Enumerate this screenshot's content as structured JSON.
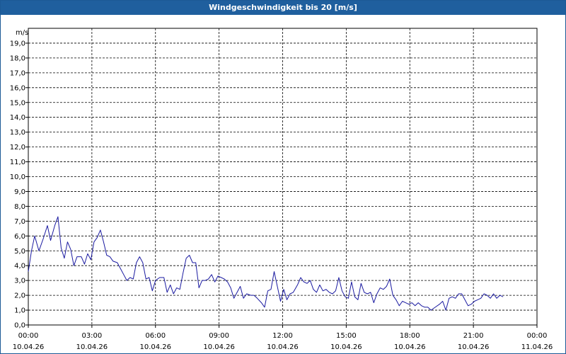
{
  "window": {
    "title": "Windgeschwindigkeit bis 20 [m/s]"
  },
  "chart_data": {
    "type": "line",
    "title": "Windgeschwindigkeit bis 20 [m/s]",
    "ylabel": "m/s",
    "xlabel": "",
    "ylim": [
      0,
      20
    ],
    "xlim_hours": [
      0,
      24
    ],
    "grid": true,
    "y_ticks": [
      "0,0",
      "1,0",
      "2,0",
      "3,0",
      "4,0",
      "5,0",
      "6,0",
      "7,0",
      "8,0",
      "9,0",
      "10,0",
      "11,0",
      "12,0",
      "13,0",
      "14,0",
      "15,0",
      "16,0",
      "17,0",
      "18,0",
      "19,0"
    ],
    "x_ticks": [
      {
        "time": "00:00",
        "date": "10.04.26"
      },
      {
        "time": "03:00",
        "date": "10.04.26"
      },
      {
        "time": "06:00",
        "date": "10.04.26"
      },
      {
        "time": "09:00",
        "date": "10.04.26"
      },
      {
        "time": "12:00",
        "date": "10.04.26"
      },
      {
        "time": "15:00",
        "date": "10.04.26"
      },
      {
        "time": "18:00",
        "date": "10.04.26"
      },
      {
        "time": "21:00",
        "date": "10.04.26"
      },
      {
        "time": "00:00",
        "date": "11.04.26"
      }
    ],
    "series": [
      {
        "color": "#1a1aa0",
        "points": [
          [
            0.0,
            3.6
          ],
          [
            0.15,
            5.0
          ],
          [
            0.3,
            6.0
          ],
          [
            0.5,
            5.0
          ],
          [
            0.7,
            5.8
          ],
          [
            0.9,
            6.7
          ],
          [
            1.05,
            5.7
          ],
          [
            1.25,
            6.7
          ],
          [
            1.4,
            7.3
          ],
          [
            1.55,
            5.2
          ],
          [
            1.7,
            4.5
          ],
          [
            1.85,
            5.6
          ],
          [
            2.0,
            5.1
          ],
          [
            2.15,
            4.0
          ],
          [
            2.3,
            4.6
          ],
          [
            2.5,
            4.6
          ],
          [
            2.65,
            4.1
          ],
          [
            2.8,
            4.8
          ],
          [
            2.95,
            4.4
          ],
          [
            3.1,
            5.6
          ],
          [
            3.25,
            5.9
          ],
          [
            3.4,
            6.4
          ],
          [
            3.55,
            5.6
          ],
          [
            3.7,
            4.7
          ],
          [
            3.85,
            4.6
          ],
          [
            4.0,
            4.3
          ],
          [
            4.2,
            4.2
          ],
          [
            4.35,
            3.8
          ],
          [
            4.5,
            3.4
          ],
          [
            4.65,
            3.0
          ],
          [
            4.8,
            3.2
          ],
          [
            4.95,
            3.1
          ],
          [
            5.1,
            4.2
          ],
          [
            5.25,
            4.6
          ],
          [
            5.4,
            4.2
          ],
          [
            5.55,
            3.1
          ],
          [
            5.7,
            3.2
          ],
          [
            5.85,
            2.3
          ],
          [
            6.0,
            3.0
          ],
          [
            6.2,
            3.2
          ],
          [
            6.4,
            3.2
          ],
          [
            6.55,
            2.2
          ],
          [
            6.7,
            2.7
          ],
          [
            6.85,
            2.1
          ],
          [
            7.0,
            2.5
          ],
          [
            7.15,
            2.4
          ],
          [
            7.3,
            3.5
          ],
          [
            7.45,
            4.5
          ],
          [
            7.6,
            4.7
          ],
          [
            7.75,
            4.2
          ],
          [
            7.9,
            4.2
          ],
          [
            8.05,
            2.5
          ],
          [
            8.2,
            3.0
          ],
          [
            8.35,
            3.0
          ],
          [
            8.5,
            3.1
          ],
          [
            8.65,
            3.4
          ],
          [
            8.8,
            2.9
          ],
          [
            8.95,
            3.3
          ],
          [
            9.1,
            3.2
          ],
          [
            9.25,
            3.1
          ],
          [
            9.4,
            2.9
          ],
          [
            9.55,
            2.5
          ],
          [
            9.7,
            1.8
          ],
          [
            9.85,
            2.2
          ],
          [
            10.0,
            2.6
          ],
          [
            10.15,
            1.8
          ],
          [
            10.3,
            2.1
          ],
          [
            10.5,
            2.0
          ],
          [
            10.65,
            2.0
          ],
          [
            10.8,
            1.8
          ],
          [
            11.0,
            1.5
          ],
          [
            11.15,
            1.2
          ],
          [
            11.3,
            2.3
          ],
          [
            11.45,
            2.4
          ],
          [
            11.6,
            3.6
          ],
          [
            11.75,
            2.6
          ],
          [
            11.9,
            1.6
          ],
          [
            12.05,
            2.4
          ],
          [
            12.2,
            1.7
          ],
          [
            12.35,
            2.1
          ],
          [
            12.5,
            2.2
          ],
          [
            12.7,
            2.7
          ],
          [
            12.85,
            3.2
          ],
          [
            13.0,
            2.9
          ],
          [
            13.15,
            2.8
          ],
          [
            13.3,
            3.0
          ],
          [
            13.45,
            2.4
          ],
          [
            13.6,
            2.2
          ],
          [
            13.75,
            2.7
          ],
          [
            13.9,
            2.3
          ],
          [
            14.05,
            2.4
          ],
          [
            14.2,
            2.2
          ],
          [
            14.35,
            2.1
          ],
          [
            14.5,
            2.3
          ],
          [
            14.65,
            3.2
          ],
          [
            14.8,
            2.3
          ],
          [
            14.95,
            1.9
          ],
          [
            15.1,
            1.8
          ],
          [
            15.25,
            2.9
          ],
          [
            15.4,
            1.9
          ],
          [
            15.55,
            1.7
          ],
          [
            15.7,
            2.8
          ],
          [
            15.85,
            2.2
          ],
          [
            16.0,
            2.1
          ],
          [
            16.15,
            2.2
          ],
          [
            16.3,
            1.5
          ],
          [
            16.45,
            2.1
          ],
          [
            16.6,
            2.5
          ],
          [
            16.75,
            2.4
          ],
          [
            16.9,
            2.6
          ],
          [
            17.05,
            3.1
          ],
          [
            17.2,
            2.0
          ],
          [
            17.35,
            1.7
          ],
          [
            17.5,
            1.3
          ],
          [
            17.65,
            1.6
          ],
          [
            17.8,
            1.5
          ],
          [
            17.95,
            1.4
          ],
          [
            18.1,
            1.5
          ],
          [
            18.25,
            1.3
          ],
          [
            18.4,
            1.5
          ],
          [
            18.55,
            1.3
          ],
          [
            18.7,
            1.2
          ],
          [
            18.85,
            1.2
          ],
          [
            19.0,
            1.0
          ],
          [
            19.2,
            1.2
          ],
          [
            19.4,
            1.4
          ],
          [
            19.55,
            1.6
          ],
          [
            19.7,
            1.0
          ],
          [
            19.85,
            1.8
          ],
          [
            20.0,
            1.9
          ],
          [
            20.15,
            1.8
          ],
          [
            20.3,
            2.1
          ],
          [
            20.45,
            2.1
          ],
          [
            20.6,
            1.7
          ],
          [
            20.75,
            1.3
          ],
          [
            20.9,
            1.4
          ],
          [
            21.05,
            1.6
          ],
          [
            21.2,
            1.7
          ],
          [
            21.35,
            1.8
          ],
          [
            21.5,
            2.1
          ],
          [
            21.65,
            2.0
          ],
          [
            21.8,
            1.8
          ],
          [
            21.95,
            2.1
          ],
          [
            22.1,
            1.8
          ],
          [
            22.25,
            2.0
          ],
          [
            22.4,
            1.9
          ]
        ]
      }
    ]
  }
}
